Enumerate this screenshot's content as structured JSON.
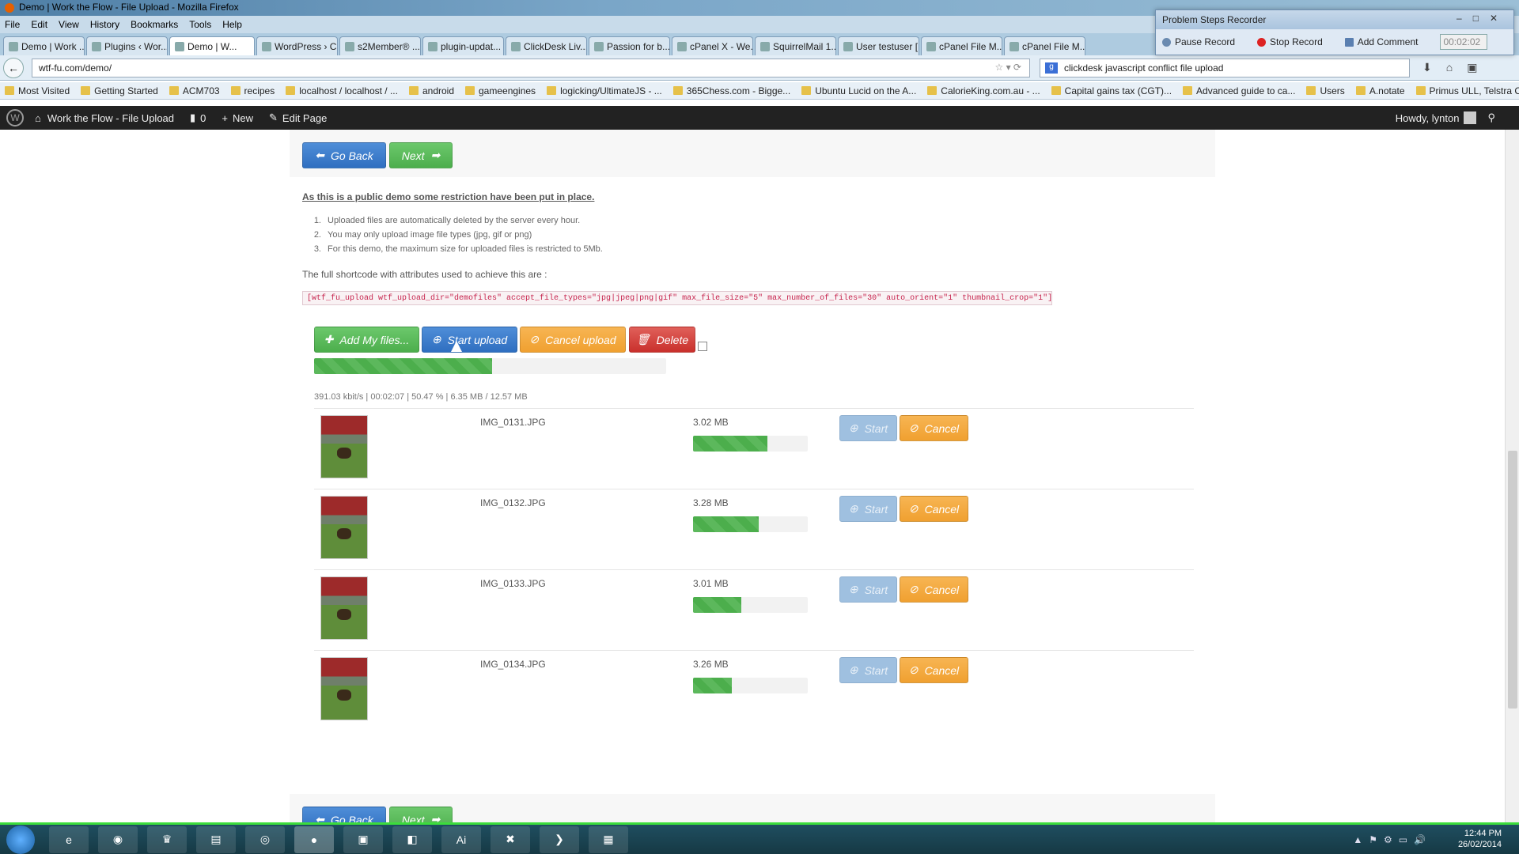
{
  "window": {
    "title": "Demo | Work the Flow - File Upload - Mozilla Firefox"
  },
  "menu": [
    "File",
    "Edit",
    "View",
    "History",
    "Bookmarks",
    "Tools",
    "Help"
  ],
  "tabs": [
    "Demo | Work ...",
    "Plugins ‹ Wor...",
    "Demo | W...",
    "WordPress › C...",
    "s2Member® ...",
    "plugin-updat...",
    "ClickDesk Liv...",
    "Passion for b...",
    "cPanel X - We...",
    "SquirrelMail 1...",
    "User testuser [...",
    "cPanel File M...",
    "cPanel File M..."
  ],
  "nav": {
    "url": "wtf-fu.com/demo/",
    "search": "clickdesk javascript conflict file upload"
  },
  "bookmarks": [
    "Most Visited",
    "Getting Started",
    "ACM703",
    "recipes",
    "localhost / localhost / ...",
    "android",
    "gameengines",
    "logicking/UltimateJS - ...",
    "365Chess.com - Bigge...",
    "Ubuntu Lucid on the A...",
    "CalorieKing.com.au - ...",
    "Capital gains tax (CGT)...",
    "Advanced guide to ca...",
    "Users",
    "A.notate",
    "Primus ULL, Telstra Co..."
  ],
  "wpbar": {
    "site": "Work the Flow - File Upload",
    "comments": "0",
    "new": "New",
    "edit": "Edit Page",
    "howdy": "Howdy, lynton"
  },
  "psr": {
    "title": "Problem Steps Recorder",
    "pause": "Pause Record",
    "stop": "Stop Record",
    "comment": "Add Comment",
    "timer": "00:02:02"
  },
  "page": {
    "go_back": "Go Back",
    "next": "Next",
    "notice": "As this is a public demo some restriction have been put in place.",
    "rules": [
      "Uploaded files are automatically deleted by the server every hour.",
      "You may only upload image file types (jpg, gif or png)",
      "For this demo, the maximum size for uploaded files is restricted to 5Mb."
    ],
    "shortcode_intro": "The full shortcode with attributes used to achieve this are :",
    "shortcode": "[wtf_fu_upload wtf_upload_dir=\"demofiles\" accept_file_types=\"jpg|jpeg|png|gif\" max_file_size=\"5\" max_number_of_files=\"30\" auto_orient=\"1\" thumbnail_crop=\"1\"]",
    "add_files": "Add My files...",
    "start_upload": "Start upload",
    "cancel_upload": "Cancel upload",
    "delete": "Delete",
    "overall_progress": 0.5047,
    "stats": "391.03 kbit/s | 00:02:07 | 50.47 % | 6.35 MB / 12.57 MB",
    "start": "Start",
    "cancel": "Cancel",
    "files": [
      {
        "name": "IMG_0131.JPG",
        "size": "3.02 MB",
        "progress": 0.65
      },
      {
        "name": "IMG_0132.JPG",
        "size": "3.28 MB",
        "progress": 0.57
      },
      {
        "name": "IMG_0133.JPG",
        "size": "3.01 MB",
        "progress": 0.42
      },
      {
        "name": "IMG_0134.JPG",
        "size": "3.26 MB",
        "progress": 0.34
      }
    ]
  },
  "clock": {
    "time": "12:44 PM",
    "date": "26/02/2014"
  }
}
